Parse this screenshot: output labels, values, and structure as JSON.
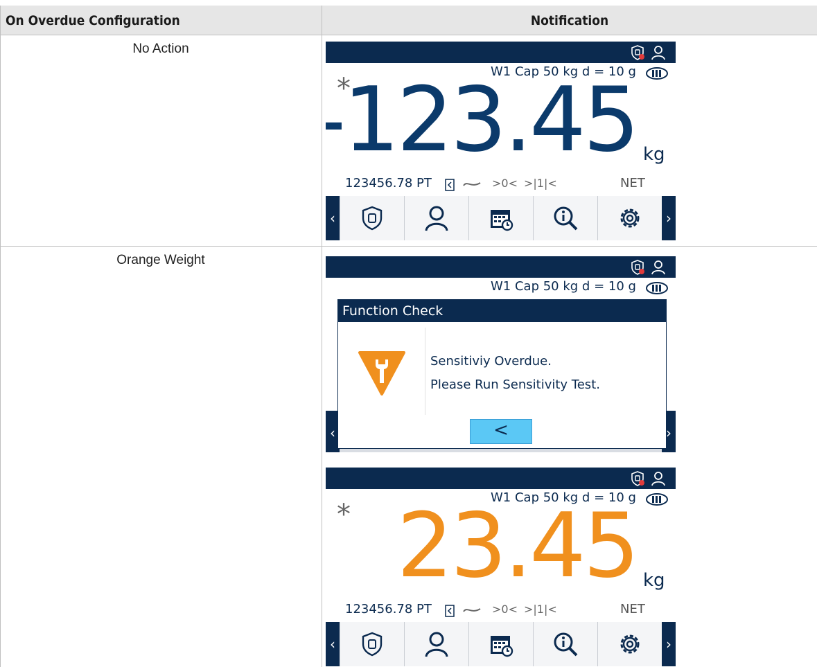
{
  "table": {
    "header": {
      "config": "On Overdue Configuration",
      "notification": "Notification"
    },
    "rows": [
      {
        "config": "No Action"
      },
      {
        "config": "Orange Weight"
      }
    ]
  },
  "screens": {
    "s1": {
      "capacity": "W1 Cap 50 kg d = 10 g",
      "star": "*",
      "weight": "-123.45",
      "unit": "kg",
      "tare": "123456.78 PT",
      "zero": ">0<",
      "range": ">|1|<",
      "net": "NET",
      "weight_color": "#0b3a6b"
    },
    "dialog": {
      "capacity": "W1 Cap 50 kg d = 10 g",
      "title": "Function Check",
      "line1": "Sensitiviy Overdue.",
      "line2": "Please Run Sensitivity Test.",
      "back": "<"
    },
    "s3": {
      "capacity": "W1 Cap 50 kg d = 10 g",
      "star": "*",
      "weight": "23.45",
      "unit": "kg",
      "tare": "123456.78 PT",
      "zero": ">0<",
      "range": ">|1|<",
      "net": "NET",
      "weight_color": "#f0901e"
    }
  },
  "colors": {
    "navy": "#0b2a4f",
    "warning_orange": "#f0901e",
    "back_blue": "#5bc8f5"
  },
  "icons": [
    "shield-weight-icon",
    "user-icon",
    "calendar-clock-icon",
    "info-search-icon",
    "gear-icon",
    "prev-arrow-icon",
    "next-arrow-icon",
    "wrench-warning-icon",
    "battery-icon"
  ]
}
